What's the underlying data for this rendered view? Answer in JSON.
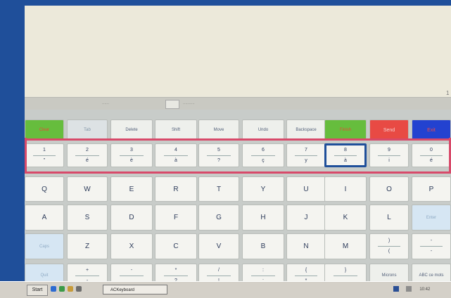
{
  "midbar": {
    "seg1": "......",
    "seg2": "..........",
    "seg3": ".........."
  },
  "function_row": [
    {
      "label": "Clear",
      "style": "green"
    },
    {
      "label": "Tab",
      "style": "gray"
    },
    {
      "label": "Delete",
      "style": "f"
    },
    {
      "label": "Shift",
      "style": "f"
    },
    {
      "label": "Move",
      "style": "f"
    },
    {
      "label": "Undo",
      "style": "f"
    },
    {
      "label": "Backspace",
      "style": "f"
    },
    {
      "label": "Finish",
      "style": "green"
    },
    {
      "label": "Send",
      "style": "red"
    },
    {
      "label": "Exit",
      "style": "bluebtn"
    }
  ],
  "number_row": [
    {
      "top": "1",
      "bottom": "\""
    },
    {
      "top": "2",
      "bottom": "é"
    },
    {
      "top": "3",
      "bottom": "è"
    },
    {
      "top": "4",
      "bottom": "à"
    },
    {
      "top": "5",
      "bottom": "?"
    },
    {
      "top": "6",
      "bottom": "ç"
    },
    {
      "top": "7",
      "bottom": "y"
    },
    {
      "top": "8",
      "bottom": "à"
    },
    {
      "top": "9",
      "bottom": "i"
    },
    {
      "top": "0",
      "bottom": "é"
    }
  ],
  "row_q": [
    "Q",
    "W",
    "E",
    "R",
    "T",
    "Y",
    "U",
    "I",
    "O",
    "P"
  ],
  "row_a": [
    "A",
    "S",
    "D",
    "F",
    "G",
    "H",
    "J",
    "K",
    "L",
    "Enter"
  ],
  "row_z": [
    "Caps",
    "Z",
    "X",
    "C",
    "V",
    "B",
    "N",
    "M"
  ],
  "row_z_extra": [
    {
      "top": ")",
      "bottom": "("
    },
    {
      "top": "-",
      "bottom": "-"
    }
  ],
  "row_bottom": [
    {
      "label": "Quit",
      "style": "blue"
    },
    {
      "top": "+",
      "bottom": "-"
    },
    {
      "top": "-",
      "bottom": "."
    },
    {
      "top": "*",
      "bottom": "?"
    },
    {
      "top": "/",
      "bottom": "!"
    },
    {
      "top": ":",
      "bottom": ";"
    },
    {
      "top": "{",
      "bottom": "*"
    },
    {
      "top": "}",
      "bottom": "_"
    },
    {
      "label": "Microns",
      "style": "f"
    },
    {
      "label": "ABC ce mots",
      "style": "f"
    }
  ],
  "taskbar": {
    "start": "Start",
    "task": "ACKeyboard",
    "tray": "10:42"
  },
  "colors": {
    "desktop": "#1f4f9a",
    "highlight": "#d84a6a"
  }
}
